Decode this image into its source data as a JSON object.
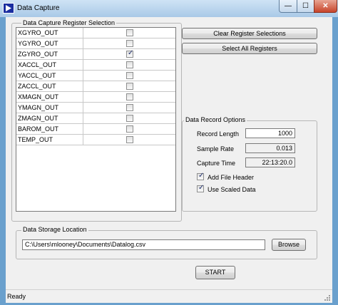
{
  "window": {
    "title": "Data Capture",
    "minimize_label": "—",
    "maximize_label": "☐",
    "close_label": "✕"
  },
  "register_selection": {
    "title": "Data Capture Register Selection",
    "registers": [
      {
        "name": "XGYRO_OUT",
        "checked": false
      },
      {
        "name": "YGYRO_OUT",
        "checked": false
      },
      {
        "name": "ZGYRO_OUT",
        "checked": true
      },
      {
        "name": "XACCL_OUT",
        "checked": false
      },
      {
        "name": "YACCL_OUT",
        "checked": false
      },
      {
        "name": "ZACCL_OUT",
        "checked": false
      },
      {
        "name": "XMAGN_OUT",
        "checked": false
      },
      {
        "name": "YMAGN_OUT",
        "checked": false
      },
      {
        "name": "ZMAGN_OUT",
        "checked": false
      },
      {
        "name": "BAROM_OUT",
        "checked": false
      },
      {
        "name": "TEMP_OUT",
        "checked": false
      }
    ]
  },
  "actions": {
    "clear_label": "Clear Register Selections",
    "select_all_label": "Select All Registers"
  },
  "record_options": {
    "title": "Data Record Options",
    "record_length_label": "Record Length",
    "record_length_value": "1000",
    "sample_rate_label": "Sample Rate",
    "sample_rate_value": "0.013",
    "capture_time_label": "Capture Time",
    "capture_time_value": "22:13:20.0",
    "add_file_header_label": "Add File Header",
    "add_file_header_checked": true,
    "use_scaled_data_label": "Use Scaled Data",
    "use_scaled_data_checked": true
  },
  "storage": {
    "title": "Data Storage Location",
    "path": "C:\\Users\\mlooney\\Documents\\Datalog.csv",
    "browse_label": "Browse"
  },
  "start_label": "START",
  "status": {
    "text": "Ready"
  }
}
